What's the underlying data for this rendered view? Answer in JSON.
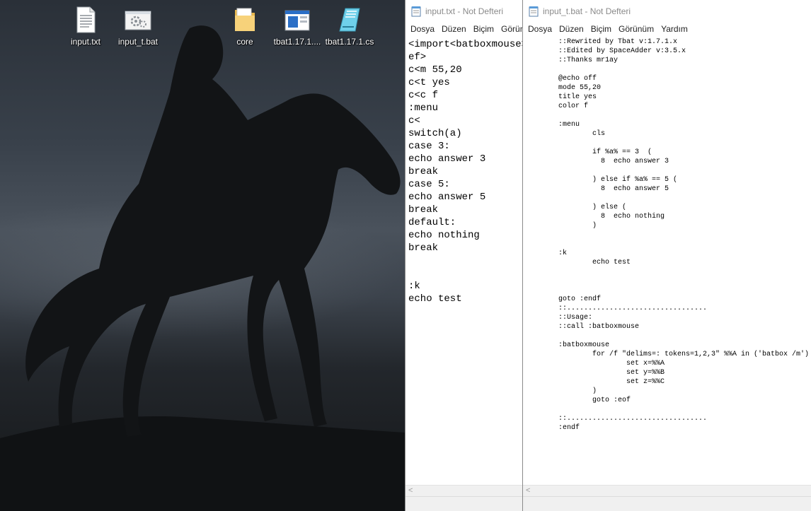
{
  "desktop": {
    "icons": [
      {
        "label": "input.txt",
        "icon": "text-file-icon"
      },
      {
        "label": "input_t.bat",
        "icon": "batch-file-icon"
      },
      {
        "label": "core",
        "icon": "folder-icon"
      },
      {
        "label": "tbat1.17.1....",
        "icon": "application-icon"
      },
      {
        "label": "tbat1.17.1.cs",
        "icon": "cs-file-icon"
      }
    ]
  },
  "notepad_left": {
    "title": "input.txt - Not Defteri",
    "menu": [
      "Dosya",
      "Düzen",
      "Biçim",
      "Görünüm"
    ],
    "content": "<import<batboxmouse>\nef>\nc<m 55,20\nc<t yes\nc<c f\n:menu\nc<\nswitch(a)\ncase 3:\necho answer 3\nbreak\ncase 5:\necho answer 5\nbreak\ndefault:\necho nothing\nbreak\n\n\n:k\necho test"
  },
  "notepad_right": {
    "title": "input_t.bat - Not Defteri",
    "menu": [
      "Dosya",
      "Düzen",
      "Biçim",
      "Görünüm",
      "Yardım"
    ],
    "content": "::Rewrited by Tbat v:1.7.1.x\n::Edited by SpaceAdder v:3.5.x\n::Thanks mr1ay\n\n@echo off\nmode 55,20\ntitle yes\ncolor f\n\n:menu\n        cls\n\n        if %a% == 3  (\n          8  echo answer 3\n\n        ) else if %a% == 5 (\n          8  echo answer 5\n\n        ) else (\n          8  echo nothing\n        )\n\n\n:k\n        echo test\n\n\n\ngoto :endf\n::.................................\n::Usage:\n::call :batboxmouse\n\n:batboxmouse\n        for /f \"delims=: tokens=1,2,3\" %%A in ('batbox /m') do (\n                set x=%%A\n                set y=%%B\n                set z=%%C\n        )\n        goto :eof\n\n::.................................\n:endf"
  }
}
